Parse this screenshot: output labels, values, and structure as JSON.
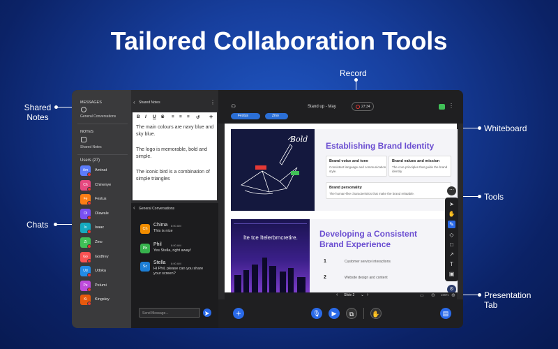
{
  "title": "Tailored Collaboration Tools",
  "callouts": {
    "record": "Record",
    "shared_notes": "Shared\nNotes",
    "chats": "Chats",
    "whiteboard": "Whiteboard",
    "tools": "Tools",
    "presentation_tab": "Presentation\nTab"
  },
  "sidebar": {
    "messages_header": "MESSAGES",
    "general_conversations": "General Conversations",
    "notes_header": "NOTES",
    "shared_notes": "Shared Notes",
    "users_header": "Users (27)",
    "users": [
      {
        "initials": "Am",
        "name": "Aminat",
        "color": "#5c7cfa"
      },
      {
        "initials": "Ch",
        "name": "Chinenye",
        "color": "#e64980"
      },
      {
        "initials": "Fe",
        "name": "Festus",
        "color": "#fd7e14"
      },
      {
        "initials": "Ol",
        "name": "Olawale",
        "color": "#7950f2"
      },
      {
        "initials": "Is",
        "name": "Isaac",
        "color": "#15aabf"
      },
      {
        "initials": "Zi",
        "name": "Zino",
        "color": "#40c057"
      },
      {
        "initials": "Go",
        "name": "Godfrey",
        "color": "#fa5252"
      },
      {
        "initials": "Ud",
        "name": "Udoka",
        "color": "#228be6"
      },
      {
        "initials": "Pe",
        "name": "Pelumi",
        "color": "#be4bdb"
      },
      {
        "initials": "Ki",
        "name": "Kingsley",
        "color": "#e8590c"
      }
    ]
  },
  "notes_panel": {
    "header": "Shared Notes",
    "toolbar": [
      "B",
      "I",
      "U",
      "S",
      "≡",
      "≡",
      "≡",
      "↺",
      "+"
    ],
    "paragraphs": [
      "The main colours are navy blue and sky blue.",
      "The logo is memorable, bold and simple.",
      "The iconic bird is a combination of simple triangles"
    ]
  },
  "chat_panel": {
    "header": "General Conversations",
    "messages": [
      {
        "initials": "Ch",
        "name": "Chima",
        "time": "8:00 AM",
        "text": "This is nice",
        "color": "#f08c00"
      },
      {
        "initials": "Ph",
        "name": "Phil",
        "time": "8:00 AM",
        "text": "Yes Stella, right away!",
        "color": "#37b24d"
      },
      {
        "initials": "Sc",
        "name": "Stella",
        "time": "8:00 AM",
        "text": "Hi Phil, please can you share your screen?",
        "color": "#1c7ed6"
      }
    ],
    "input_placeholder": "Send Message..."
  },
  "stage": {
    "meeting_title": "Stand up - May",
    "record_time": "27:34",
    "participants": [
      "Festus",
      "Zino"
    ],
    "slide1": {
      "title": "Establishing Brand Identity",
      "cards": [
        {
          "title": "Brand voice and tone",
          "desc": "Consistent language and communication style."
        },
        {
          "title": "Brand values and mission",
          "desc": "The core principles that guide the brand identity"
        },
        {
          "title": "Brand personality",
          "desc": "The human-like characteristics that make the brand relatable."
        }
      ],
      "art_label": "Bold"
    },
    "slide2": {
      "title": "Developing a Consistent Brand Experience",
      "hero_text": "Ite tce Itelerbrncretire.",
      "steps": [
        {
          "num": "1",
          "text": "Customer service interactions"
        },
        {
          "num": "2",
          "text": "Website design and content"
        }
      ]
    },
    "presentation_tab": {
      "slide_label": "Slide 2",
      "zoom": "100%"
    }
  },
  "colors": {
    "accent": "#2a6ae8",
    "slide_title": "#6b4ed1",
    "record": "#e53935"
  }
}
